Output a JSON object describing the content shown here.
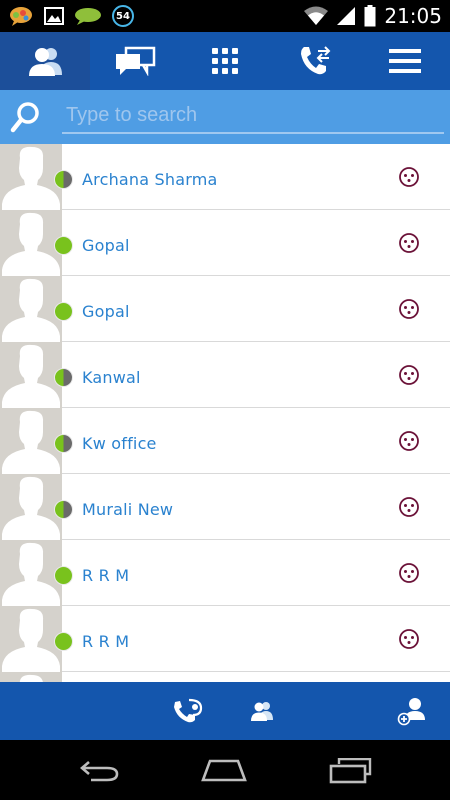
{
  "status_bar": {
    "notification_badge": "54",
    "time": "21:05"
  },
  "top_nav": {
    "tabs": [
      {
        "id": "contacts",
        "icon": "contacts-icon",
        "active": true
      },
      {
        "id": "messages",
        "icon": "chat-icon",
        "active": false
      },
      {
        "id": "dialpad",
        "icon": "dialpad-icon",
        "active": false
      },
      {
        "id": "calls",
        "icon": "call-log-icon",
        "active": false
      },
      {
        "id": "menu",
        "icon": "menu-icon",
        "active": false
      }
    ]
  },
  "search": {
    "placeholder": "Type to search",
    "value": ""
  },
  "contacts": [
    {
      "name": "Archana Sharma",
      "presence": "away"
    },
    {
      "name": "Gopal",
      "presence": "online"
    },
    {
      "name": "Gopal",
      "presence": "online"
    },
    {
      "name": "Kanwal",
      "presence": "away"
    },
    {
      "name": "Kw office",
      "presence": "away"
    },
    {
      "name": "Murali New",
      "presence": "away"
    },
    {
      "name": "R R M",
      "presence": "online"
    },
    {
      "name": "R R M",
      "presence": "online"
    }
  ],
  "bottom_bar": {
    "buttons": [
      "app-contacts-icon",
      "group-icon",
      "add-contact-icon"
    ]
  },
  "colors": {
    "primary_blue": "#1456ad",
    "search_blue": "#4f9de4",
    "name_blue": "#2a82cf",
    "online_green": "#79c21d",
    "away_gray": "#6a6a6a",
    "action_maroon": "#6b1238"
  }
}
